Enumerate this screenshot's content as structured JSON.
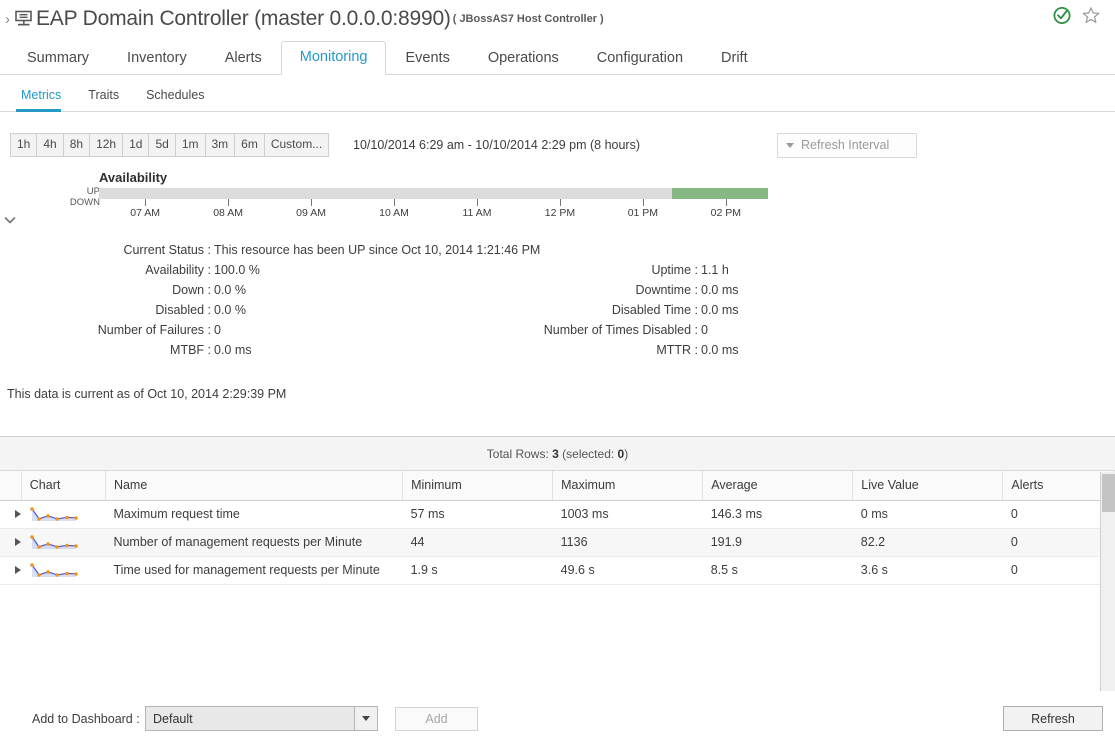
{
  "header": {
    "breadcrumb_chevron": "chevron-right",
    "title": "EAP Domain Controller (master 0.0.0.0:8990)",
    "subtitle": "( JBossAS7 Host Controller )",
    "availability_icon": "availability-up-icon",
    "favorite_icon": "star-icon",
    "colors": {
      "available": "#2e9244",
      "star": "#9a9a9a",
      "accent": "#2699c6"
    }
  },
  "tabs": [
    {
      "label": "Summary",
      "active": false
    },
    {
      "label": "Inventory",
      "active": false
    },
    {
      "label": "Alerts",
      "active": false
    },
    {
      "label": "Monitoring",
      "active": true
    },
    {
      "label": "Events",
      "active": false
    },
    {
      "label": "Operations",
      "active": false
    },
    {
      "label": "Configuration",
      "active": false
    },
    {
      "label": "Drift",
      "active": false
    }
  ],
  "subtabs": [
    {
      "label": "Metrics",
      "active": true
    },
    {
      "label": "Traits",
      "active": false
    },
    {
      "label": "Schedules",
      "active": false
    }
  ],
  "toolbar": {
    "range_buttons": [
      "1h",
      "4h",
      "8h",
      "12h",
      "1d",
      "5d",
      "1m",
      "3m",
      "6m",
      "Custom..."
    ],
    "range_label": "10/10/2014 6:29 am - 10/10/2014 2:29 pm (8 hours)",
    "refresh_interval_label": "Refresh Interval"
  },
  "availability": {
    "title": "Availability",
    "axis_top": "UP",
    "axis_bottom": "DOWN",
    "tick_labels": [
      "07 AM",
      "08 AM",
      "09 AM",
      "10 AM",
      "11 AM",
      "12 PM",
      "01 PM",
      "02 PM"
    ],
    "down_color": "#dcdcdc",
    "up_color": "#86b884",
    "up_segment_start_pct": 85.6,
    "up_segment_end_pct": 100
  },
  "details": {
    "left": [
      {
        "label": "Current Status :",
        "value": "This resource has been UP since Oct 10, 2014 1:21:46 PM"
      },
      {
        "label": "Availability :",
        "value": "100.0 %"
      },
      {
        "label": "Down :",
        "value": "0.0 %"
      },
      {
        "label": "Disabled :",
        "value": "0.0 %"
      },
      {
        "label": "Number of Failures :",
        "value": "0"
      },
      {
        "label": "MTBF :",
        "value": "0.0 ms"
      }
    ],
    "right": [
      {
        "label": "Uptime :",
        "value": "1.1 h"
      },
      {
        "label": "Downtime :",
        "value": "0.0 ms"
      },
      {
        "label": "Disabled Time :",
        "value": "0.0 ms"
      },
      {
        "label": "Number of Times Disabled :",
        "value": "0"
      },
      {
        "label": "MTTR :",
        "value": "0.0 ms"
      }
    ],
    "current_as_of": "This data is current as of Oct 10, 2014 2:29:39 PM"
  },
  "table": {
    "total_rows_prefix": "Total Rows:",
    "total_rows": "3",
    "selected_prefix": "(selected:",
    "selected": "0",
    "selected_suffix": ")",
    "columns": [
      "Chart",
      "Name",
      "Minimum",
      "Maximum",
      "Average",
      "Live Value",
      "Alerts"
    ],
    "rows": [
      {
        "name": "Maximum request time",
        "minimum": "57 ms",
        "maximum": "1003 ms",
        "average": "146.3 ms",
        "live_value": "0 ms",
        "alerts": "0"
      },
      {
        "name": "Number of management requests per Minute",
        "minimum": "44",
        "maximum": "1136",
        "average": "191.9",
        "live_value": "82.2",
        "alerts": "0"
      },
      {
        "name": "Time used for management requests per Minute",
        "minimum": "1.9 s",
        "maximum": "49.6 s",
        "average": "8.5 s",
        "live_value": "3.6 s",
        "alerts": "0"
      }
    ]
  },
  "footer": {
    "add_to_dashboard_label": "Add to Dashboard :",
    "dashboard_selected": "Default",
    "add_button": "Add",
    "refresh_button": "Refresh"
  }
}
